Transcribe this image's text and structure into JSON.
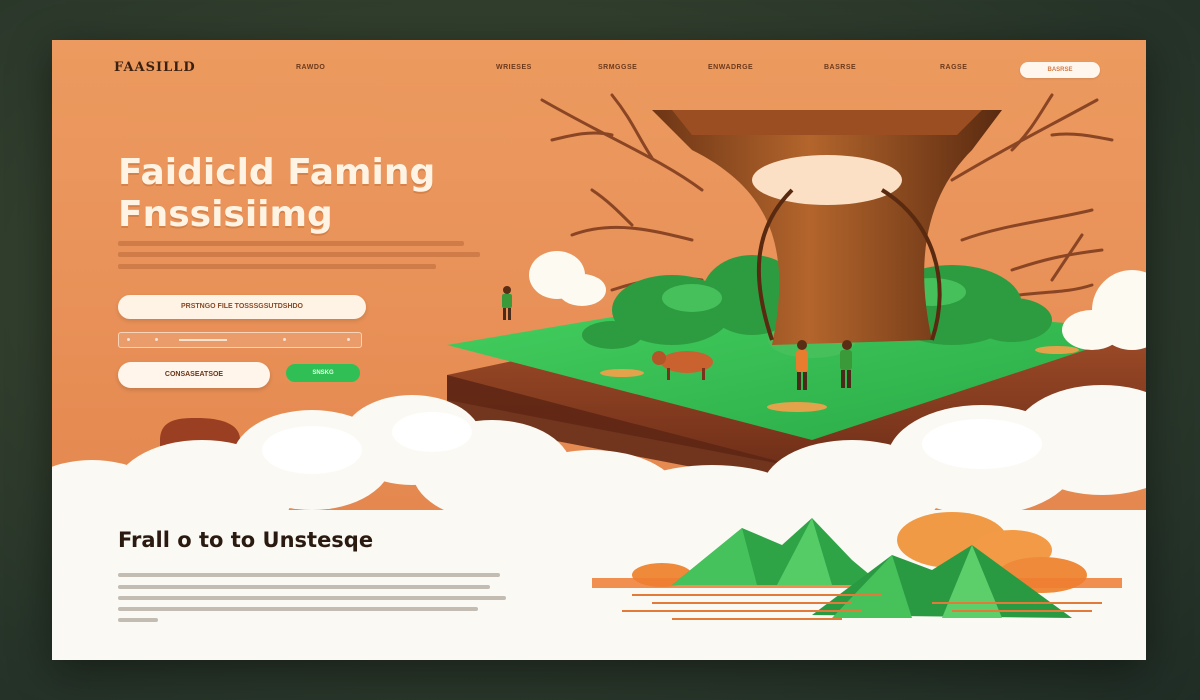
{
  "brand": {
    "logo_text": "FAASILLD"
  },
  "nav": {
    "links": [
      "RAWDO",
      "WRIESES",
      "SRMGGSE",
      "ENWADRGE",
      "BASRSE",
      "RAGSE"
    ],
    "cta_label": "BASRSE"
  },
  "hero": {
    "headline_line1": "Faidicld Faming",
    "headline_line2": "Fnssisiimg",
    "input_label": "PRSTNGO FILE TOSSSGSUTDSHDO",
    "primary_button": "CONSASEATSOE",
    "green_button": "SNSKG"
  },
  "section": {
    "title": "Frall o to to Unstesqe"
  },
  "colors": {
    "hero_bg": "#e9935a",
    "accent_green": "#2fbf55",
    "headline": "#fff4e4",
    "tree_brown": "#8a4a22",
    "grass": "#3cbf4e"
  },
  "icons": [
    "tree-illustration",
    "floating-island",
    "cloud",
    "mountain",
    "farmer-figure",
    "animal-figure"
  ]
}
